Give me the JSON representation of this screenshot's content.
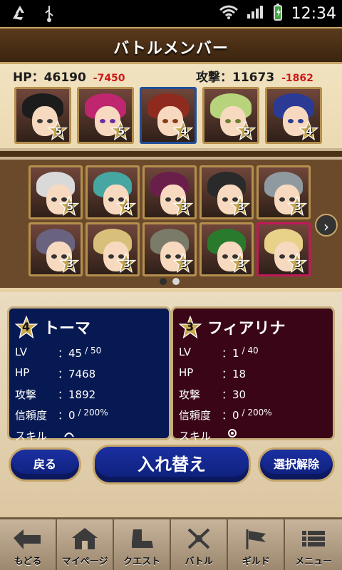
{
  "statusbar": {
    "time": "12:34",
    "icons": [
      "recycle-icon",
      "usb-icon",
      "wifi-icon",
      "signal-icon",
      "battery-icon"
    ]
  },
  "header": {
    "title": "バトルメンバー"
  },
  "stats": {
    "hp_label": "HP：46190",
    "hp_diff": "-7450",
    "atk_label": "攻撃：11673",
    "atk_diff": "-1862"
  },
  "party": [
    {
      "star": "5",
      "hair": "#1c1c1c",
      "eyes": "#3a3a3a"
    },
    {
      "star": "5",
      "hair": "#c0266f",
      "eyes": "#6b2ea0"
    },
    {
      "star": "4",
      "hair": "#8f2b1e",
      "eyes": "#8a3a1a",
      "selected": "blue"
    },
    {
      "star": "5",
      "hair": "#b7d37b",
      "eyes": "#6b7f2e"
    },
    {
      "star": "4",
      "hair": "#2b3b95",
      "eyes": "#2b3b95"
    }
  ],
  "box": [
    {
      "star": "5",
      "hair": "#d9d9d9"
    },
    {
      "star": "4",
      "hair": "#46a6a1"
    },
    {
      "star": "3",
      "hair": "#6a1f4b"
    },
    {
      "star": "3",
      "hair": "#2a2a2a"
    },
    {
      "star": "3",
      "hair": "#8e9aa0"
    },
    {
      "star": "3",
      "hair": "#6a6380"
    },
    {
      "star": "3",
      "hair": "#d9c07a"
    },
    {
      "star": "3",
      "hair": "#7b7b6a"
    },
    {
      "star": "3",
      "hair": "#2a7a2d"
    },
    {
      "star": "3",
      "hair": "#e8d28a",
      "selected": "pink"
    }
  ],
  "pager": {
    "active": 1,
    "total": 2
  },
  "left_card": {
    "rank": "4",
    "name": "トーマ",
    "lv_label": "LV",
    "lv_value": "：45",
    "lv_max": "/ 50",
    "hp_label": "HP",
    "hp_value": "：7468",
    "atk_label": "攻撃",
    "atk_value": "：1892",
    "trust_label": "信頼度",
    "trust_value": "：0",
    "trust_max": "/ 200%",
    "skill_label": "スキル"
  },
  "right_card": {
    "rank": "3",
    "name": "フィアリナ",
    "lv_label": "LV",
    "lv_value": "：1",
    "lv_max": "/ 40",
    "hp_label": "HP",
    "hp_value": "：18",
    "atk_label": "攻撃",
    "atk_value": "：30",
    "trust_label": "信頼度",
    "trust_value": "：0",
    "trust_max": "/ 200%",
    "skill_label": "スキル"
  },
  "buttons": {
    "back": "戻る",
    "swap": "入れ替え",
    "clear": "選択解除"
  },
  "nav": [
    {
      "label": "もどる",
      "icon": "back-arrow-icon"
    },
    {
      "label": "マイページ",
      "icon": "house-icon"
    },
    {
      "label": "クエスト",
      "icon": "boots-icon"
    },
    {
      "label": "バトル",
      "icon": "crossed-swords-icon"
    },
    {
      "label": "ギルド",
      "icon": "guild-flag-icon"
    },
    {
      "label": "メニュー",
      "icon": "menu-icon"
    }
  ]
}
